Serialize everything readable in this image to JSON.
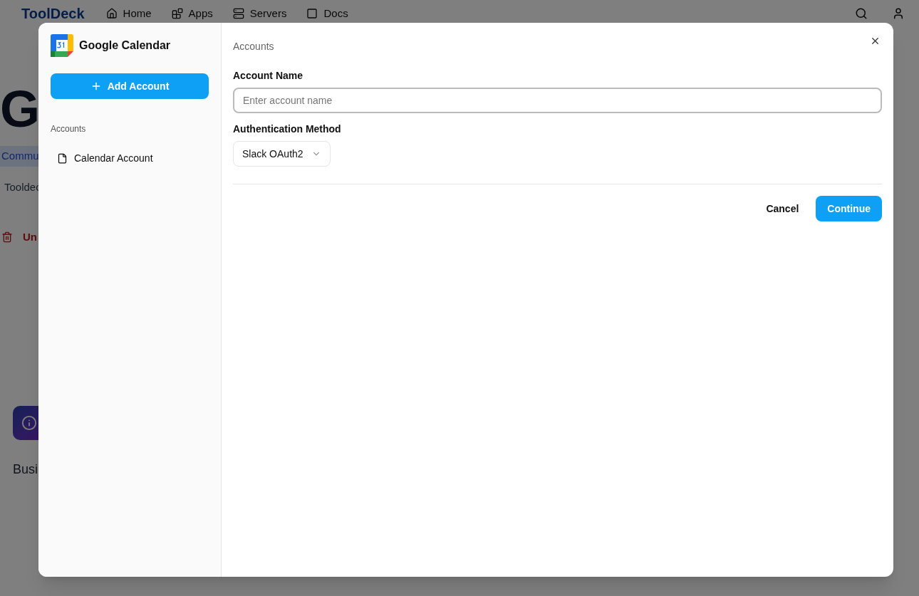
{
  "background_page": {
    "logo": "ToolDeck",
    "nav": [
      {
        "label": "Home"
      },
      {
        "label": "Apps"
      },
      {
        "label": "Servers"
      },
      {
        "label": "Docs"
      }
    ],
    "heading": "G",
    "badge": "Commu",
    "description": "Tooldec",
    "danger_action": "Un",
    "section_title": "Busi"
  },
  "dialog": {
    "app_name": "Google Calendar",
    "add_button": "Add Account",
    "sidebar_heading": "Accounts",
    "accounts": [
      {
        "name": "Calendar Account",
        "selected": false
      }
    ],
    "breadcrumb": "Accounts",
    "fields": [
      {
        "kind": "text",
        "label": "Account Name",
        "placeholder": "Enter account name",
        "focused": true
      },
      {
        "kind": "select",
        "label": "Authentication Method",
        "value": "Slack OAuth2"
      }
    ],
    "buttons": [
      {
        "label": "Cancel",
        "kind": "secondary"
      },
      {
        "label": "Continue",
        "kind": "primary"
      }
    ]
  }
}
